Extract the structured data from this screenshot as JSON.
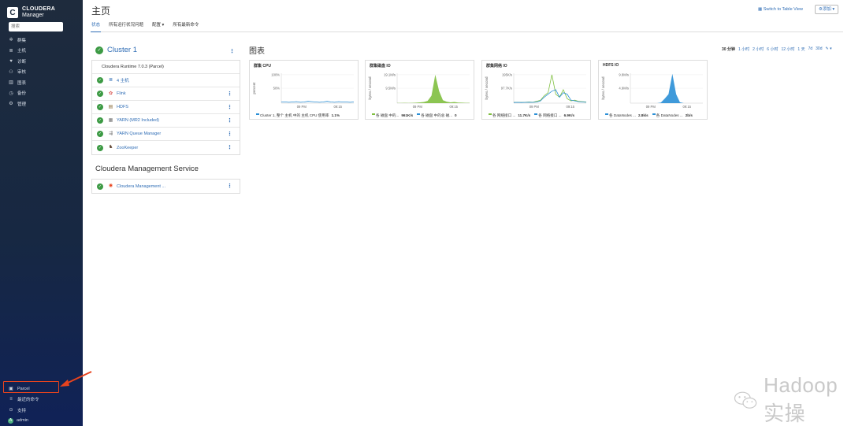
{
  "brand": {
    "line1": "CLOUDERA",
    "line2": "Manager",
    "logo_letter": "C"
  },
  "search": {
    "placeholder": "搜索"
  },
  "nav": [
    {
      "label": "群集",
      "icon": "cluster-icon"
    },
    {
      "label": "主机",
      "icon": "hosts-icon"
    },
    {
      "label": "诊断",
      "icon": "diagnostics-icon"
    },
    {
      "label": "审核",
      "icon": "audit-icon"
    },
    {
      "label": "图表",
      "icon": "charts-icon"
    },
    {
      "label": "备份",
      "icon": "backup-icon"
    },
    {
      "label": "管理",
      "icon": "gear-icon"
    }
  ],
  "bottom_nav": [
    {
      "label": "Parcel",
      "icon": "parcel-icon"
    },
    {
      "label": "最近的命令",
      "icon": "commands-icon"
    },
    {
      "label": "支持",
      "icon": "support-icon"
    },
    {
      "label": "admin",
      "icon": "avatar-icon",
      "avatar_letter": "A"
    }
  ],
  "header": {
    "title": "主页",
    "table_view": "Switch to Table View",
    "add": "添加"
  },
  "tabs": [
    {
      "label": "状态",
      "active": true
    },
    {
      "label": "所有运行状况问题"
    },
    {
      "label": "配置 ▾"
    },
    {
      "label": "所有最新命令"
    }
  ],
  "cluster": {
    "name": "Cluster 1",
    "runtime": "Cloudera Runtime 7.0.3 (Parcel)",
    "services": [
      {
        "name": "4 主机",
        "icon": "hosts-icon"
      },
      {
        "name": "Flink",
        "icon": "flink-icon"
      },
      {
        "name": "HDFS",
        "icon": "hdfs-icon"
      },
      {
        "name": "YARN (MR2 Included)",
        "icon": "yarn-icon"
      },
      {
        "name": "YARN Queue Manager",
        "icon": "queue-icon"
      },
      {
        "name": "ZooKeeper",
        "icon": "zookeeper-icon"
      }
    ]
  },
  "mgmt": {
    "title": "Cloudera Management Service",
    "services": [
      {
        "name": "Cloudera Management ...",
        "icon": "cm-icon"
      }
    ]
  },
  "charts_section": {
    "title": "图表",
    "time_range": [
      "30 分钟",
      "1 小时",
      "2 小时",
      "6 小时",
      "12 小时",
      "1 天",
      "7d",
      "30d",
      "✎ ▾"
    ]
  },
  "chart_data": [
    {
      "type": "line",
      "title": "群集 CPU",
      "ylabel": "percent",
      "y_ticks": [
        "100%",
        "50%"
      ],
      "x_ticks": [
        "09 PM",
        "09:15"
      ],
      "x": [
        0,
        1,
        2,
        3,
        4,
        5,
        6,
        7,
        8,
        9,
        10,
        11,
        12,
        13,
        14,
        15,
        16,
        17,
        18,
        19
      ],
      "series": [
        {
          "name": "Cluster 1, 整个 主机 中的 主机 CPU 使用率",
          "color": "#2a8fd6",
          "values": [
            4,
            4,
            3,
            4,
            5,
            3,
            4,
            6,
            5,
            4,
            3,
            4,
            6,
            4,
            3,
            5,
            4,
            4,
            3,
            4
          ]
        }
      ],
      "legend": [
        {
          "label": "Cluster 1, 整个 主机 中的 主机 CPU 使用率",
          "value": "1.1%",
          "color": "#2a8fd6"
        }
      ],
      "ylim": [
        0,
        100
      ]
    },
    {
      "type": "area",
      "title": "群集磁盘 IO",
      "ylabel": "bytes / second",
      "y_ticks": [
        "19.1M/s",
        "9.5M/s"
      ],
      "x_ticks": [
        "09 PM",
        "09:15"
      ],
      "x": [
        0,
        1,
        2,
        3,
        4,
        5,
        6,
        7,
        8,
        9,
        10,
        11,
        12,
        13,
        14,
        15,
        16,
        17,
        18,
        19
      ],
      "series": [
        {
          "name": "各 磁盘 中的...",
          "color": "#7fbf3f",
          "values": [
            0.1,
            0.1,
            0.2,
            0.1,
            0.2,
            0.3,
            0.5,
            0.8,
            1.5,
            5,
            19,
            8,
            2,
            1,
            0.5,
            0.8,
            0.4,
            0.3,
            0.2,
            0.2
          ]
        }
      ],
      "legend": [
        {
          "label": "各 磁盘 中的...",
          "value": "961K/s",
          "color": "#7fbf3f"
        },
        {
          "label": "各 磁盘 中的总 磁...",
          "value": "0",
          "color": "#2a8fd6"
        }
      ],
      "ylim": [
        0,
        20
      ]
    },
    {
      "type": "line",
      "title": "群集网络 IO",
      "ylabel": "bytes / second",
      "y_ticks": [
        "195K/s",
        "97.7K/s"
      ],
      "x_ticks": [
        "09 PM",
        "09:15"
      ],
      "x": [
        0,
        1,
        2,
        3,
        4,
        5,
        6,
        7,
        8,
        9,
        10,
        11,
        12,
        13,
        14,
        15,
        16,
        17,
        18,
        19
      ],
      "series": [
        {
          "name": "各 网络接口 ...",
          "color": "#7fbf3f",
          "values": [
            5,
            6,
            5,
            6,
            8,
            6,
            12,
            20,
            50,
            70,
            190,
            60,
            40,
            90,
            30,
            15,
            20,
            12,
            10,
            8
          ]
        },
        {
          "name": "各 网络接口 ...",
          "color": "#2a8fd6",
          "values": [
            4,
            5,
            4,
            5,
            6,
            5,
            8,
            15,
            40,
            60,
            80,
            90,
            40,
            70,
            60,
            20,
            15,
            10,
            8,
            6
          ]
        }
      ],
      "legend": [
        {
          "label": "各 网络接口 ...",
          "value": "11.7K/s",
          "color": "#7fbf3f"
        },
        {
          "label": "各 网络接口 ...",
          "value": "6.9K/s",
          "color": "#2a8fd6"
        }
      ],
      "ylim": [
        0,
        200
      ]
    },
    {
      "type": "area",
      "title": "HDFS IO",
      "ylabel": "bytes / second",
      "y_ticks": [
        "9.8M/s",
        "4.9M/s"
      ],
      "x_ticks": [
        "09 PM",
        "09:15"
      ],
      "x": [
        0,
        1,
        2,
        3,
        4,
        5,
        6,
        7,
        8,
        9,
        10,
        11,
        12,
        13,
        14,
        15,
        16,
        17,
        18,
        19
      ],
      "series": [
        {
          "name": "各 DataNodes ...",
          "color": "#2a8fd6",
          "values": [
            0,
            0,
            0,
            0,
            0,
            0,
            0,
            0,
            0.2,
            1.5,
            3,
            9.8,
            3,
            0.3,
            0,
            0,
            0,
            0,
            0,
            0
          ]
        }
      ],
      "legend": [
        {
          "label": "各 DataNodes ...",
          "value": "2.8k/s",
          "color": "#2a8fd6"
        },
        {
          "label": "各 DataNodes ...",
          "value": "2b/s",
          "color": "#2a8fd6"
        }
      ],
      "ylim": [
        0,
        10
      ]
    }
  ],
  "watermark": {
    "text": "Hadoop实操"
  },
  "colors": {
    "accent": "#2f6db5",
    "ok": "#3c9a44",
    "annotation": "#e8431e"
  }
}
